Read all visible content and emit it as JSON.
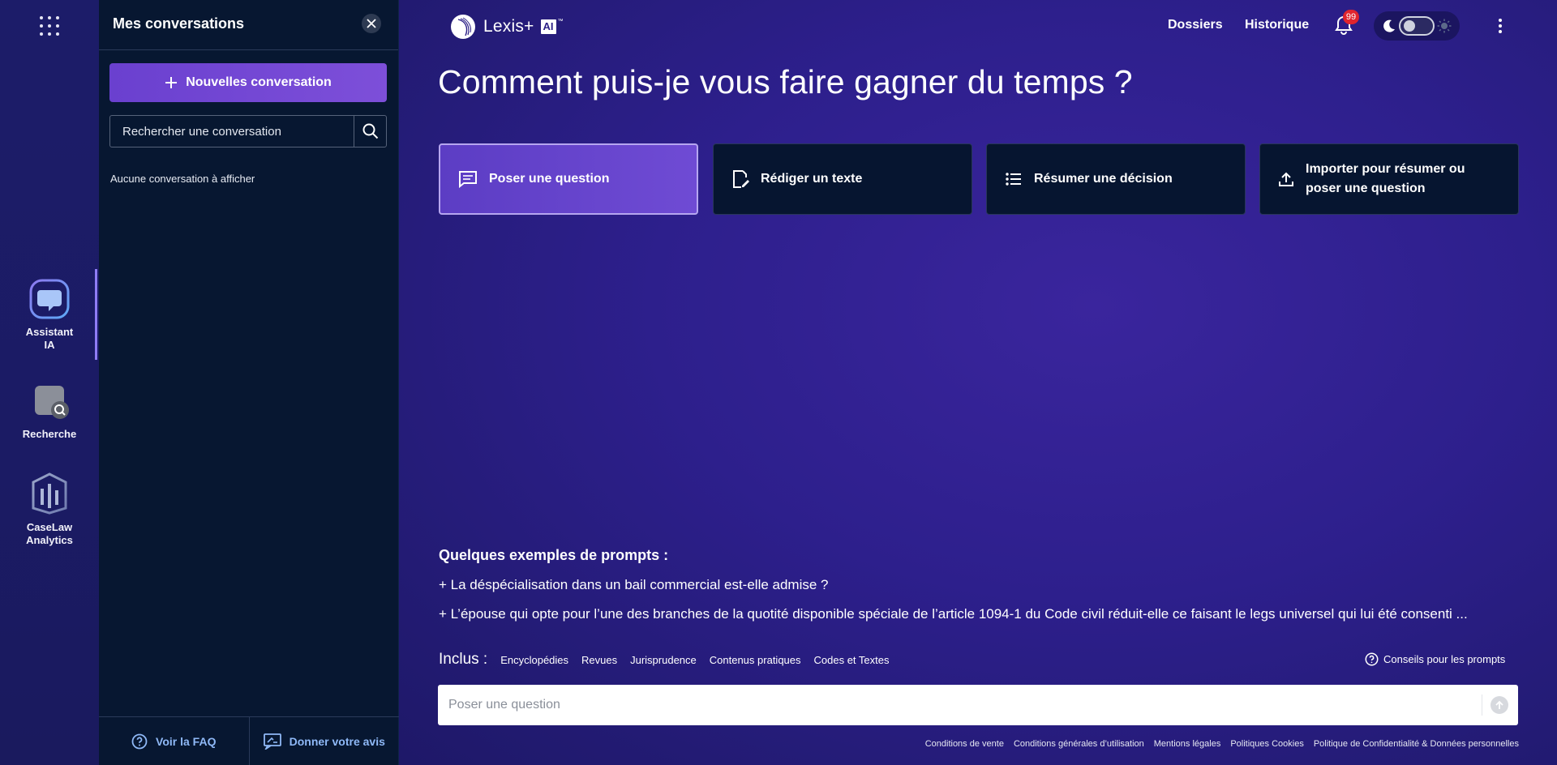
{
  "rail": {
    "items": [
      {
        "label_line1": "Assistant",
        "label_line2": "IA"
      },
      {
        "label_line1": "Recherche",
        "label_line2": ""
      },
      {
        "label_line1": "CaseLaw",
        "label_line2": "Analytics"
      }
    ]
  },
  "panel": {
    "title": "Mes conversations",
    "new_conversation": "Nouvelles conversation",
    "search_placeholder": "Rechercher une conversation",
    "empty_text": "Aucune conversation à afficher",
    "footer": {
      "faq": "Voir la FAQ",
      "feedback": "Donner votre avis"
    }
  },
  "header": {
    "brand": "Lexis+",
    "brand_badge": "AI",
    "brand_tm": "™",
    "nav": [
      "Dossiers",
      "Historique"
    ],
    "notifications_count": "99"
  },
  "main": {
    "hero": "Comment puis-je vous faire gagner du temps ?",
    "actions": [
      {
        "label": "Poser une question",
        "icon": "chat-lines-icon",
        "active": true
      },
      {
        "label": "Rédiger un texte",
        "icon": "edit-document-icon",
        "active": false
      },
      {
        "label": "Résumer une décision",
        "icon": "list-icon",
        "active": false
      },
      {
        "label": "Importer pour résumer ou poser une question",
        "icon": "upload-icon",
        "active": false
      }
    ],
    "examples_title": "Quelques exemples de prompts :",
    "examples": [
      "+ La déspécialisation dans un bail commercial est-elle admise ?",
      "+ L’épouse qui opte pour l’une des branches de la quotité disponible spéciale de l’article 1094-1 du Code civil réduit-elle ce faisant le legs universel qui lui été consenti ..."
    ],
    "inclus_label": "Inclus :",
    "inclus_items": [
      "Encyclopédies",
      "Revues",
      "Jurisprudence",
      "Contenus pratiques",
      "Codes et Textes"
    ],
    "tips": "Conseils pour les prompts",
    "ask_placeholder": "Poser une question"
  },
  "legal": [
    "Conditions de vente",
    "Conditions générales d’utilisation",
    "Mentions légales",
    "Politiques Cookies",
    "Politique de Confidentialité & Données personnelles"
  ],
  "colors": {
    "accent": "#6a40cf",
    "panel_bg": "#071731",
    "main_bg": "#2d1f8c",
    "link": "#8fb9f7",
    "badge": "#e0242e"
  }
}
